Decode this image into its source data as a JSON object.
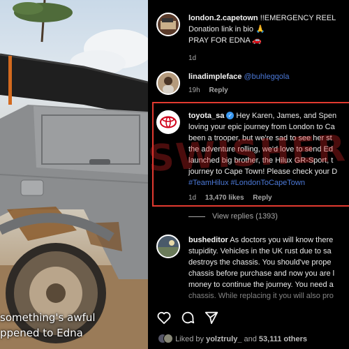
{
  "photo": {
    "caption_line1": "something's awful",
    "caption_line2": "ppened to Edna"
  },
  "watermark": "SWISHER",
  "comments": [
    {
      "username": "london.2.capetown",
      "verified": false,
      "lines": [
        "!!EMERGENCY REEL",
        "Donation link in bio 🙏",
        "PRAY FOR EDNA 🚗"
      ],
      "time": "1d"
    },
    {
      "username": "linadimpleface",
      "verified": false,
      "mention": "@buhlegqola",
      "time": "19h",
      "reply": "Reply"
    },
    {
      "username": "toyota_sa",
      "verified": true,
      "first_line": "Hey Karen, James, and Spen",
      "lines": [
        "loving your epic journey from London to Ca",
        "been a trooper, but we're sad to see her st",
        "the adventure rolling, we'd love to send Ed",
        "launched big brother, the Hilux GR-Sport, t",
        "journey to Cape Town! Please check your D"
      ],
      "hashtags": "#TeamHilux #LondonToCapeTown",
      "time": "1d",
      "likes": "13,470 likes",
      "reply": "Reply"
    },
    {
      "username": "busheditor",
      "verified": false,
      "first_line": "As doctors you will know there",
      "lines": [
        "stupidity. Vehicles in the UK rust due to sa",
        "destroys the chassis. You should've prope",
        "chassis before purchase and now you are l",
        "money to continue the journey. You need a",
        "chassis. While replacing it you will also pro"
      ]
    }
  ],
  "view_replies": "View replies (1393)",
  "actions": [
    "heart-icon",
    "comment-icon",
    "share-icon"
  ],
  "liked_by": {
    "prefix": "Liked by ",
    "user": "yolztruly_",
    "middle": " and ",
    "count": "53,111 others"
  },
  "colors": {
    "highlight": "#e23a30",
    "link": "#4b78d6",
    "verified": "#3897f0"
  }
}
